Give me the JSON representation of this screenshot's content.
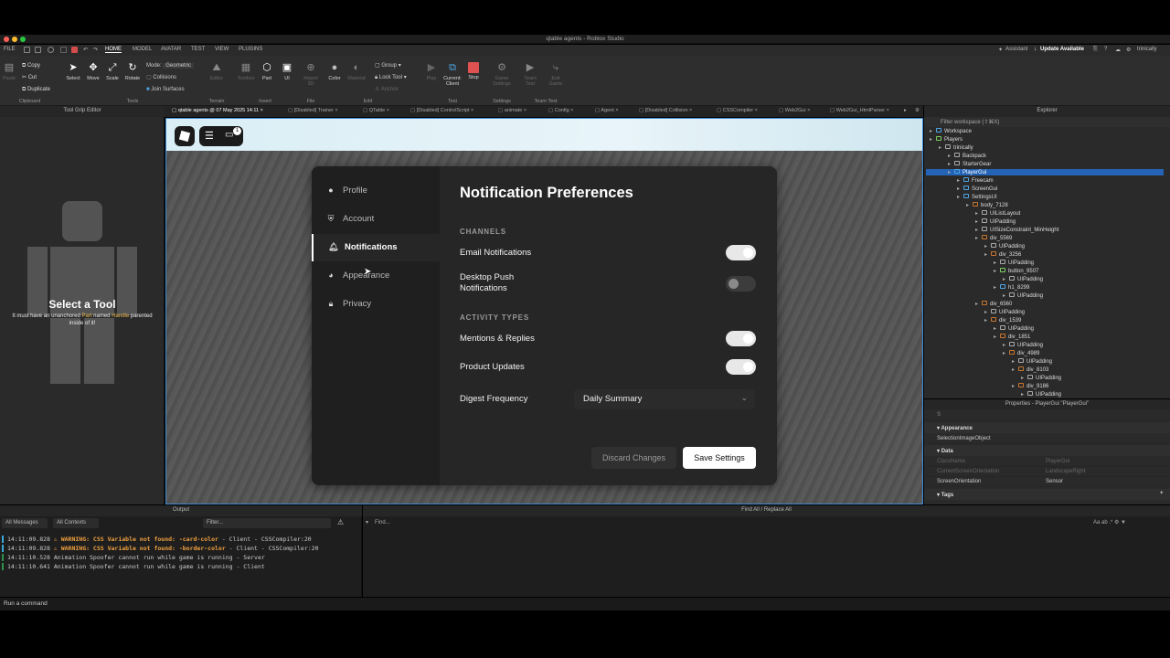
{
  "window": {
    "title": "qtable agents - Roblox Studio"
  },
  "menubar": {
    "items": [
      "FILE",
      "HOME",
      "MODEL",
      "AVATAR",
      "TEST",
      "VIEW",
      "PLUGINS"
    ],
    "assistant": "Assistant",
    "update": "Update Available",
    "user": "trinically"
  },
  "toolbar": {
    "clipboard": {
      "copy": "Copy",
      "cut": "Cut",
      "duplicate": "Duplicate",
      "paste": "Paste",
      "group": "Clipboard"
    },
    "tools": {
      "select": "Select",
      "move": "Move",
      "scale": "Scale",
      "rotate": "Rotate",
      "mode_label": "Mode:",
      "mode_value": "Geometric",
      "collisions": "Collisions",
      "join_surfaces": "Join Surfaces",
      "group": "Tools"
    },
    "terrain": {
      "editor": "Editor",
      "group": "Terrain"
    },
    "insert": {
      "toolbox": "Toolbox",
      "part": "Part",
      "ui": "UI",
      "group": "Insert"
    },
    "file": {
      "import3d": "Import 3D",
      "group": "File"
    },
    "edit": {
      "color": "Color",
      "material": "Material",
      "group_btn": "Group",
      "lock_tool": "Lock Tool",
      "anchor": "Anchor",
      "group": "Edit"
    },
    "test": {
      "play": "Play",
      "current_client": "Current: Client",
      "stop": "Stop",
      "group": "Test"
    },
    "settings": {
      "game_settings": "Game Settings",
      "group": "Settings"
    },
    "team_test": {
      "team_test": "Team Test",
      "exit_game": "Exit Game",
      "group": "Team Test"
    }
  },
  "tabs": [
    "qtable agents @ 07 May 2025 14:11",
    "[Disabled] Trainer",
    "QTable",
    "[Disabled] ControlScript",
    "animate",
    "Config",
    "Agent",
    "[Disabled] Collision",
    "CSSCompiler",
    "Web2Gui",
    "Web2Gui_HtmlParser"
  ],
  "left_pane": {
    "header": "Tool Grip Editor",
    "title": "Select a Tool",
    "sub_pre": "It must have an unanchored ",
    "sub_part": "Part",
    "sub_mid": " named ",
    "sub_handle": "Handle",
    "sub_post": " parented",
    "sub_line2": "inside of it!"
  },
  "hud": {
    "badge": "1"
  },
  "settings": {
    "nav": [
      "Profile",
      "Account",
      "Notifications",
      "Appearance",
      "Privacy"
    ],
    "title": "Notification Preferences",
    "channels_label": "CHANNELS",
    "email": "Email Notifications",
    "push_l1": "Desktop Push",
    "push_l2": "Notifications",
    "activity_label": "ACTIVITY TYPES",
    "mentions": "Mentions & Replies",
    "product": "Product Updates",
    "digest_label": "Digest Frequency",
    "digest_value": "Daily Summary",
    "discard": "Discard Changes",
    "save": "Save Settings",
    "toggles": {
      "email": true,
      "push": false,
      "mentions": true,
      "product": true
    }
  },
  "explorer": {
    "header": "Explorer",
    "filter": "Filter workspace (⇧⌘X)",
    "tree": [
      "Workspace",
      "Players",
      "trinically",
      "Backpack",
      "StarterGear",
      "PlayerGui",
      "Freecam",
      "ScreenGui",
      "SettingsUI",
      "body_7128",
      "UIListLayout",
      "UIPadding",
      "UISizeConstraint_MinHeight",
      "div_5569",
      "UIPadding",
      "div_3256",
      "UIPadding",
      "button_9507",
      "UIPadding",
      "h1_8299",
      "UIPadding",
      "div_6560",
      "UIPadding",
      "div_1539",
      "UIPadding",
      "div_1851",
      "UIPadding",
      "div_4989",
      "UIPadding",
      "div_8103",
      "UIPadding",
      "div_9186",
      "UIPadding"
    ]
  },
  "properties": {
    "header": "Properties - PlayerGui \"PlayerGui\"",
    "search": "S",
    "appearance": "Appearance",
    "selection_image_object": "SelectionImageObject",
    "data": "Data",
    "classname": "ClassName",
    "classname_value": "PlayerGui",
    "current_orientation": "CurrentScreenOrientation",
    "current_orientation_value": "LandscapeRight",
    "screen_orientation": "ScreenOrientation",
    "screen_orientation_value": "Sensor",
    "tags": "Tags"
  },
  "output": {
    "header": "Output",
    "all_messages": "All Messages",
    "all_contexts": "All Contexts",
    "filter": "Filter...",
    "logs": [
      {
        "time": "14:11:09.828",
        "warn": "⚠ WARNING: CSS Variable not found: -card-color",
        "rest": "  -  Client - CSSCompiler:20"
      },
      {
        "time": "14:11:09.828",
        "warn": "⚠ WARNING: CSS Variable not found: -border-color",
        "rest": "  -  Client - CSSCompiler:20"
      },
      {
        "time": "14:11:10.528",
        "warn": "",
        "rest": "Animation Spoofer cannot run while game is running  -  Server"
      },
      {
        "time": "14:11:10.641",
        "warn": "",
        "rest": "Animation Spoofer cannot run while game is running  -  Client"
      }
    ]
  },
  "find": {
    "header": "Find All / Replace All",
    "placeholder": "Find..."
  },
  "command": {
    "placeholder": "Run a command"
  }
}
